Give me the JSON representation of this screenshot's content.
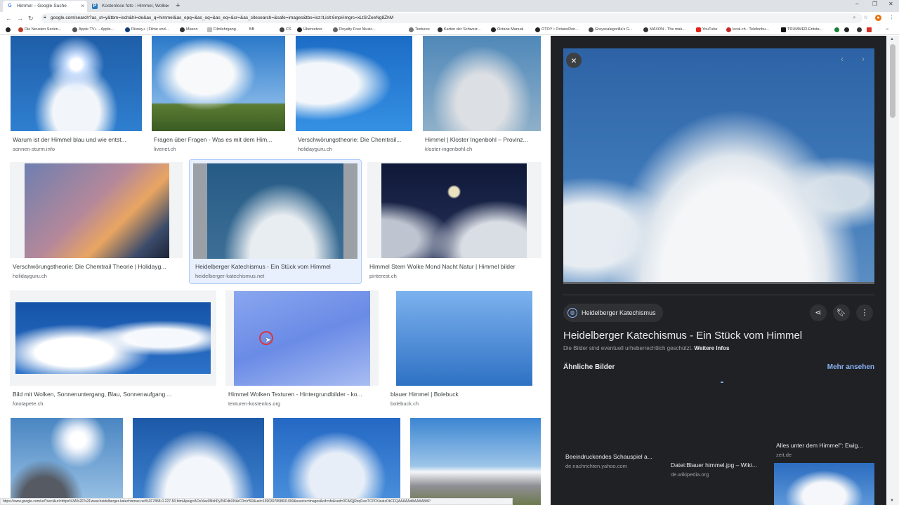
{
  "browser": {
    "tabs": [
      {
        "label": "Himmel – Google-Suche",
        "active": true
      },
      {
        "label": "Kostenlose foto : Himmel, Wolke",
        "active": false
      }
    ],
    "new_tab": "+",
    "url": "google.com/search?as_st=y&tbm=isch&hl=de&as_q=himmel&as_epq=&as_oq=&as_eq=&cr=&as_sitesearch=&safe=images&tbs=isz:lt,islt:6mp#imgrc=xLtSrZeeNg8ZhM",
    "bookmarks": [
      {
        "label": "Die Neusten Serien..."
      },
      {
        "label": "Apple TV+ – Apple..."
      },
      {
        "label": "Disney+ | Filme und..."
      },
      {
        "label": "Maxon"
      },
      {
        "label": "Filmlehrgang"
      },
      {
        "label": "BB"
      },
      {
        "label": "CS"
      },
      {
        "label": "Übersetzer"
      },
      {
        "label": "Royalty Free Music..."
      },
      {
        "label": "Textures"
      },
      {
        "label": "Karten der Schweiz..."
      },
      {
        "label": "Octane Manual"
      },
      {
        "label": "OTOY • OctaneRen..."
      },
      {
        "label": "Greyscalegorilla's G..."
      },
      {
        "label": "MAXON - The mak..."
      },
      {
        "label": "YouTube"
      },
      {
        "label": "local.ch - Telefonbu..."
      },
      {
        "label": "TRUMMER-Entsta..."
      }
    ],
    "status_url": "https://www.google.com/url?sa=i&url=https%3A%2F%2Fwww.heidelberger-katechismus.net%2F7858-0-227-50.html&psig=AOvVaw3MzhPy2NFdbXNArC0mY5R&ust=1590397898631000&source=images&cd=vfe&ved=0CAIQjRxqFwoTCPCKisaIzOkCFQAAAAAdAAAAABAP"
  },
  "results": [
    {
      "title": "Warum ist der Himmel blau und wie entst...",
      "source": "sonnen-sturm.info"
    },
    {
      "title": "Fragen über Fragen - Was es mit dem Him...",
      "source": "livenet.ch"
    },
    {
      "title": "Verschwörungstheorie: Die Chemtrail...",
      "source": "holidayguru.ch"
    },
    {
      "title": "Himmel | Kloster Ingenbohl – Provinz...",
      "source": "kloster-ingenbohl.ch"
    },
    {
      "title": "Verschwörungstheorie: Die Chemtrail Theorie | Holidayg...",
      "source": "holidayguru.ch"
    },
    {
      "title": "Heidelberger Katechismus - Ein Stück vom Himmel",
      "source": "heidelberger-katechismus.net"
    },
    {
      "title": "Himmel Stern Wolke Mond Nacht Natur | Himmel bilder",
      "source": "pinterest.ch"
    },
    {
      "title": "Bild mit Wolken, Sonnenuntergang, Blau, Sonnenaufgang ...",
      "source": "fototapete.ch"
    },
    {
      "title": "Himmel Wolken Texturen - Hintergrundbilder - ko...",
      "source": "texturen-kostenlos.org"
    },
    {
      "title": "blauer Himmel | Bolebuck",
      "source": "bolebuck.ch"
    }
  ],
  "panel": {
    "source_chip": "Heidelberger Katechismus",
    "title": "Heidelberger Katechismus - Ein Stück vom Himmel",
    "copyright": "Die Bilder sind eventuell urheberrechtlich geschützt.",
    "more_info": "Weitere Infos",
    "similar_heading": "Ähnliche Bilder",
    "more_link": "Mehr ansehen",
    "similar": [
      {
        "title": "Beeindruckendes Schauspiel a...",
        "source": "de.nachrichten.yahoo.com"
      },
      {
        "title": "Datei:Blauer himmel.jpg – Wiki...",
        "source": "de.wikipedia.org"
      },
      {
        "title": "Alles unter dem Himmel\": Ewig...",
        "source": "zeit.de"
      }
    ]
  },
  "colors": {
    "accent": "#8ab4f8",
    "panel_bg": "#202124",
    "selected_border": "#aecbfa",
    "click_indicator": "#d9363e"
  }
}
